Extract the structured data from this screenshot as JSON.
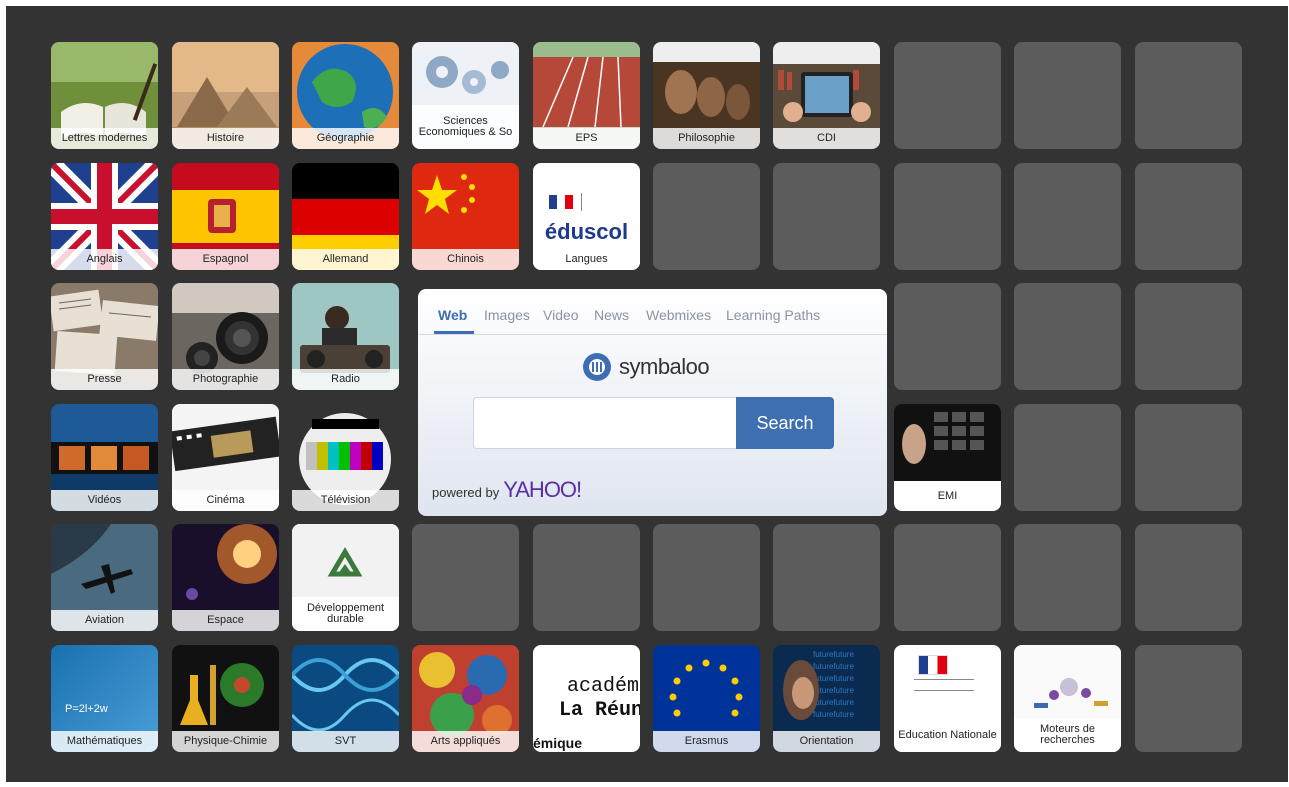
{
  "tiles": {
    "lettres": "Lettres modernes",
    "histoire": "Histoire",
    "geographie": "Géographie",
    "ses": "Sciences Economiques & So",
    "eps": "EPS",
    "philosophie": "Philosophie",
    "cdi": "CDI",
    "anglais": "Anglais",
    "espagnol": "Espagnol",
    "allemand": "Allemand",
    "chinois": "Chinois",
    "langues": "Langues",
    "presse": "Presse",
    "photographie": "Photographie",
    "radio": "Radio",
    "videos": "Vidéos",
    "cinema": "Cinéma",
    "television": "Télévision",
    "emi": "EMI",
    "aviation": "Aviation",
    "espace": "Espace",
    "developpement": "Développement durable",
    "maths": "Mathématiques",
    "physique": "Physique-Chimie",
    "svt": "SVT",
    "arts": "Arts appliqués",
    "erasmus": "Erasmus",
    "orientation": "Orientation",
    "education": "Education Nationale",
    "moteurs": "Moteurs de recherches",
    "eduscol_logo": "éduscol",
    "academie_line1": "académi",
    "academie_line2": "La Réunio",
    "academie_line3": "émique",
    "maths_formula": "P=2l+2w"
  },
  "search": {
    "tabs": [
      "Web",
      "Images",
      "Video",
      "News",
      "Webmixes",
      "Learning Paths"
    ],
    "logo": "symbaloo",
    "button": "Search",
    "placeholder": "",
    "powered": "powered by",
    "yahoo": "YAHOO!"
  },
  "colors": {
    "board": "#333333",
    "empty_tile": "#5c5c5c",
    "accent": "#3e6fb1"
  }
}
